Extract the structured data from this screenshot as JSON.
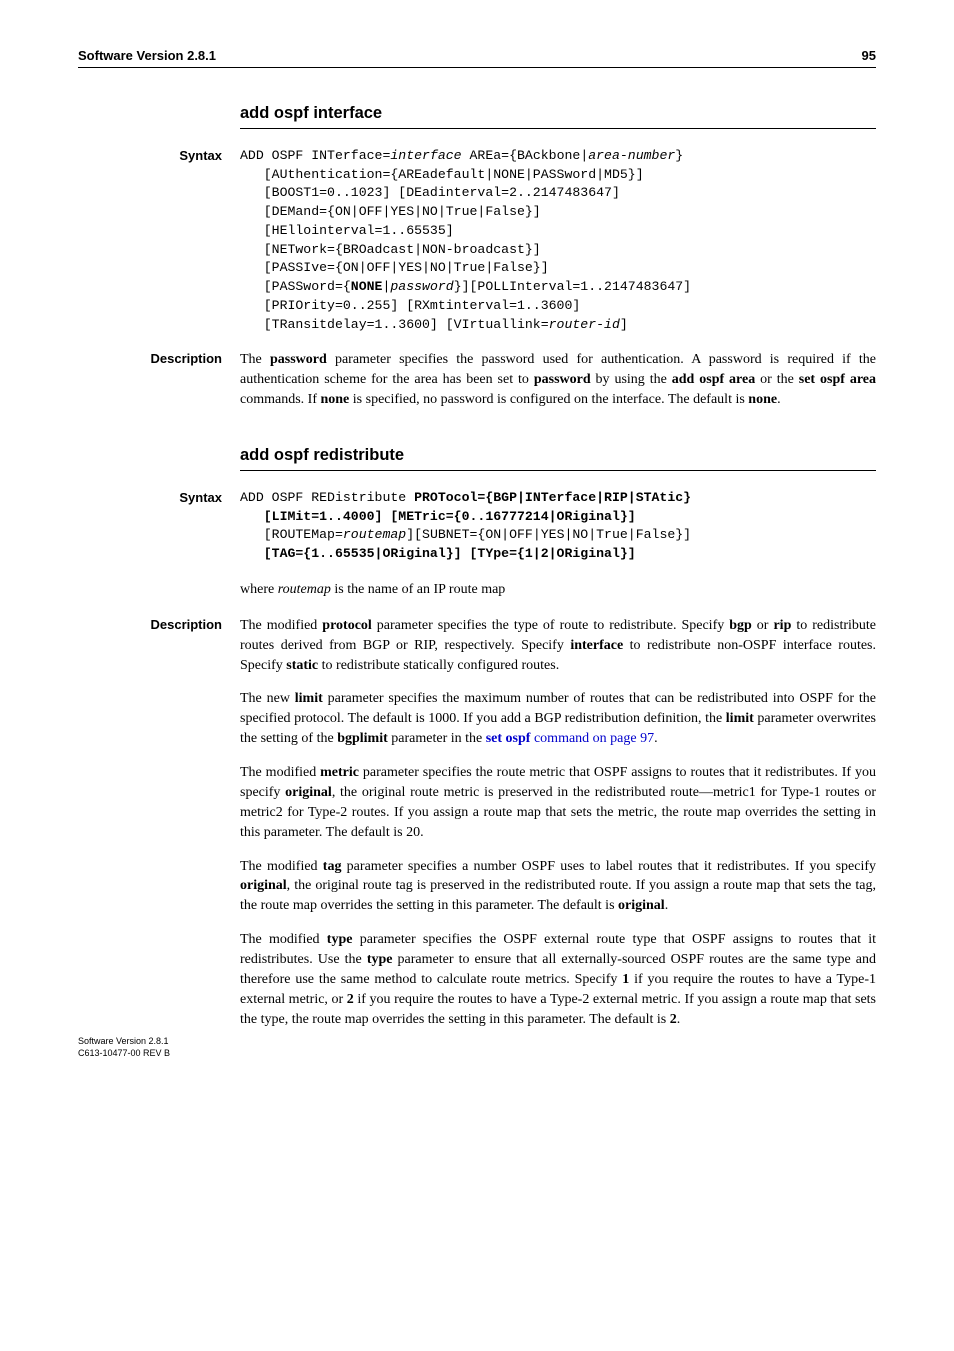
{
  "header": {
    "left": "Software Version 2.8.1",
    "right": "95"
  },
  "sections": {
    "s1": {
      "heading": "add ospf interface",
      "syntax_label": "Syntax",
      "syntax": {
        "l0a": "ADD OSPF INTerface=",
        "l0b": "interface",
        "l0c": " AREa={BAckbone|",
        "l0d": "area-number",
        "l0e": "} ",
        "l1": "   [AUthentication={AREadefault|NONE|PASSword|MD5}] ",
        "l2": "   [BOOST1=0..1023] [DEadinterval=2..2147483647] ",
        "l3": "   [DEMand={ON|OFF|YES|NO|True|False}] ",
        "l4": "   [HEllointerval=1..65535] ",
        "l5": "   [NETwork={BROadcast|NON-broadcast}] ",
        "l6": "   [PASSIve={ON|OFF|YES|NO|True|False}] ",
        "l7a": "   [PASSword={",
        "l7b": "NONE",
        "l7c": "|",
        "l7d": "password",
        "l7e": "}][POLLInterval=1..2147483647] ",
        "l8": "   [PRIOrity=0..255] [RXmtinterval=1..3600] ",
        "l9a": "   [TRansitdelay=1..3600] [VIrtuallink=",
        "l9b": "router-id",
        "l9c": "]"
      },
      "desc_label": "Description",
      "desc": {
        "p1a": "The ",
        "p1b": "password",
        "p1c": " parameter specifies the password used for authentication. A password is required if the authentication scheme for the area has been set to ",
        "p1d": "password",
        "p1e": " by using the ",
        "p1f": "add ospf area",
        "p1g": " or the ",
        "p1h": "set ospf area",
        "p1i": " commands. If ",
        "p1j": "none",
        "p1k": " is specified, no password is configured on the interface. The default is ",
        "p1l": "none",
        "p1m": "."
      }
    },
    "s2": {
      "heading": "add ospf redistribute",
      "syntax_label": "Syntax",
      "syntax": {
        "l0a": "ADD OSPF REDistribute ",
        "l0b": "PROTocol={BGP|INTerface|RIP|STAtic}",
        "l1": "   [LIMit=1..4000] [METric={0..16777214|ORiginal}]",
        "l2a": "   [ROUTEMap=",
        "l2b": "routemap",
        "l2c": "][SUBNET={ON|OFF|YES|NO|True|False}] ",
        "l3": "   [TAG={1..65535|ORiginal}] [TYpe={1|2|ORiginal}]"
      },
      "where": {
        "a": "where ",
        "b": "routemap",
        "c": " is the name of an IP route map"
      },
      "desc_label": "Description",
      "desc": {
        "p1a": "The modified ",
        "p1b": "protocol",
        "p1c": " parameter specifies the type of route to redistribute. Specify ",
        "p1d": "bgp",
        "p1e": " or ",
        "p1f": "rip",
        "p1g": " to redistribute routes derived from BGP or RIP, respectively. Specify ",
        "p1h": "interface",
        "p1i": " to redistribute non-OSPF interface routes. Specify ",
        "p1j": "static",
        "p1k": " to redistribute statically configured routes.",
        "p2a": "The new ",
        "p2b": "limit",
        "p2c": " parameter specifies the maximum number of routes that can be redistributed into OSPF for the specified protocol. The default is 1000. If you add a BGP redistribution definition, the ",
        "p2d": "limit",
        "p2e": " parameter overwrites the setting of the ",
        "p2f": "bgplimit",
        "p2g": " parameter in the ",
        "p2h": "set ospf",
        "p2i": " command on page 97",
        "p2j": ".",
        "p3a": "The modified ",
        "p3b": "metric",
        "p3c": " parameter specifies the route metric that OSPF assigns to routes that it redistributes. If you specify ",
        "p3d": "original",
        "p3e": ", the original route metric is preserved in the redistributed route—metric1 for Type-1 routes or metric2 for Type-2 routes. If you assign a route map that sets the metric, the route map overrides the setting in this parameter. The default is 20.",
        "p4a": "The modified ",
        "p4b": "tag",
        "p4c": " parameter specifies a number OSPF uses to label routes that it redistributes. If you specify ",
        "p4d": "original",
        "p4e": ", the original route tag is preserved in the redistributed route. If you assign a route map that sets the tag, the route map overrides the setting in this parameter. The default is ",
        "p4f": "original",
        "p4g": ".",
        "p5a": "The modified ",
        "p5b": "type",
        "p5c": " parameter specifies the OSPF external route type that OSPF assigns to routes that it redistributes. Use the ",
        "p5d": "type",
        "p5e": " parameter to ensure that all externally-sourced OSPF routes are the same type and therefore use the same method to calculate route metrics. Specify ",
        "p5f": "1",
        "p5g": " if you require the routes to have a Type-1 external metric, or ",
        "p5h": "2",
        "p5i": " if you require the routes to have a Type-2 external metric. If you assign a route map that sets the type, the route map overrides the setting in this parameter. The default is ",
        "p5j": "2",
        "p5k": "."
      }
    }
  },
  "footer": {
    "l1": "Software Version 2.8.1",
    "l2": "C613-10477-00 REV B"
  }
}
